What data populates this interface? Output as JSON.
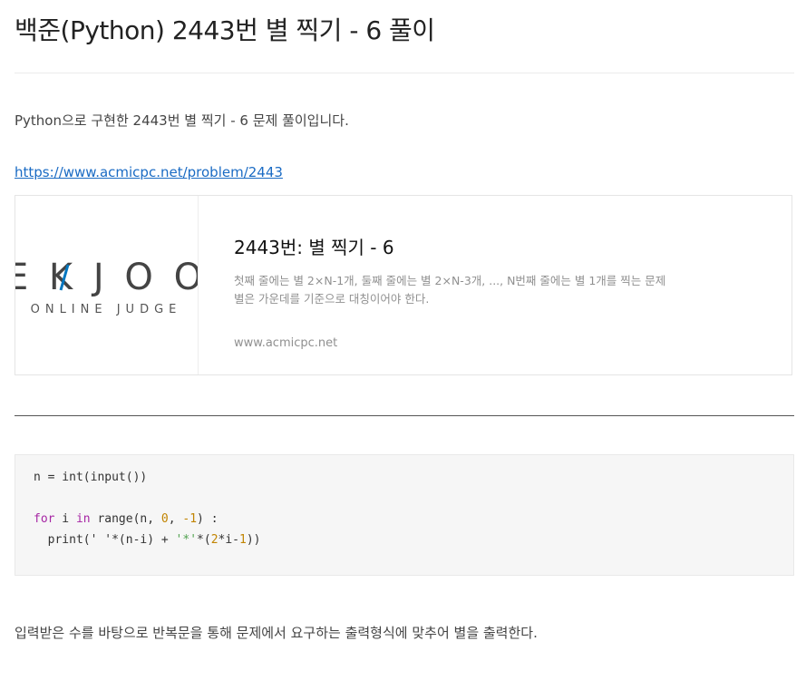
{
  "post": {
    "title": "백준(Python) 2443번 별 찍기 - 6 풀이",
    "intro": "Python으로 구현한 2443번 별 찍기 - 6 문제 풀이입니다.",
    "link": "https://www.acmicpc.net/problem/2443",
    "outro": "입력받은 수를 바탕으로 반복문을 통해 문제에서 요구하는 출력형식에 맞추어 별을 출력한다."
  },
  "og_card": {
    "logo_main": "E K J O O",
    "logo_sub": "ONLINE JUDGE",
    "title": "2443번: 별 찍기 - 6",
    "description": "첫째 줄에는 별 2×N-1개, 둘째 줄에는 별 2×N-3개, ..., N번째 줄에는 별 1개를 찍는 문제 별은 가운데를 기준으로 대칭이어야 한다.",
    "url": "www.acmicpc.net",
    "accent_color": "#0076c0"
  },
  "code": {
    "line1": {
      "text": "n = int(input())"
    },
    "line3": {
      "kw_for": "for",
      "a": " i ",
      "kw_in": "in",
      "b": " range(n, ",
      "n0": "0",
      "c": ", ",
      "n1": "-1",
      "d": ") :"
    },
    "line4": {
      "a": "  print(' '*(n-i) + ",
      "s": "'*'",
      "b": "*(",
      "n2": "2",
      "c": "*i-",
      "n3": "1",
      "d": "))"
    }
  }
}
